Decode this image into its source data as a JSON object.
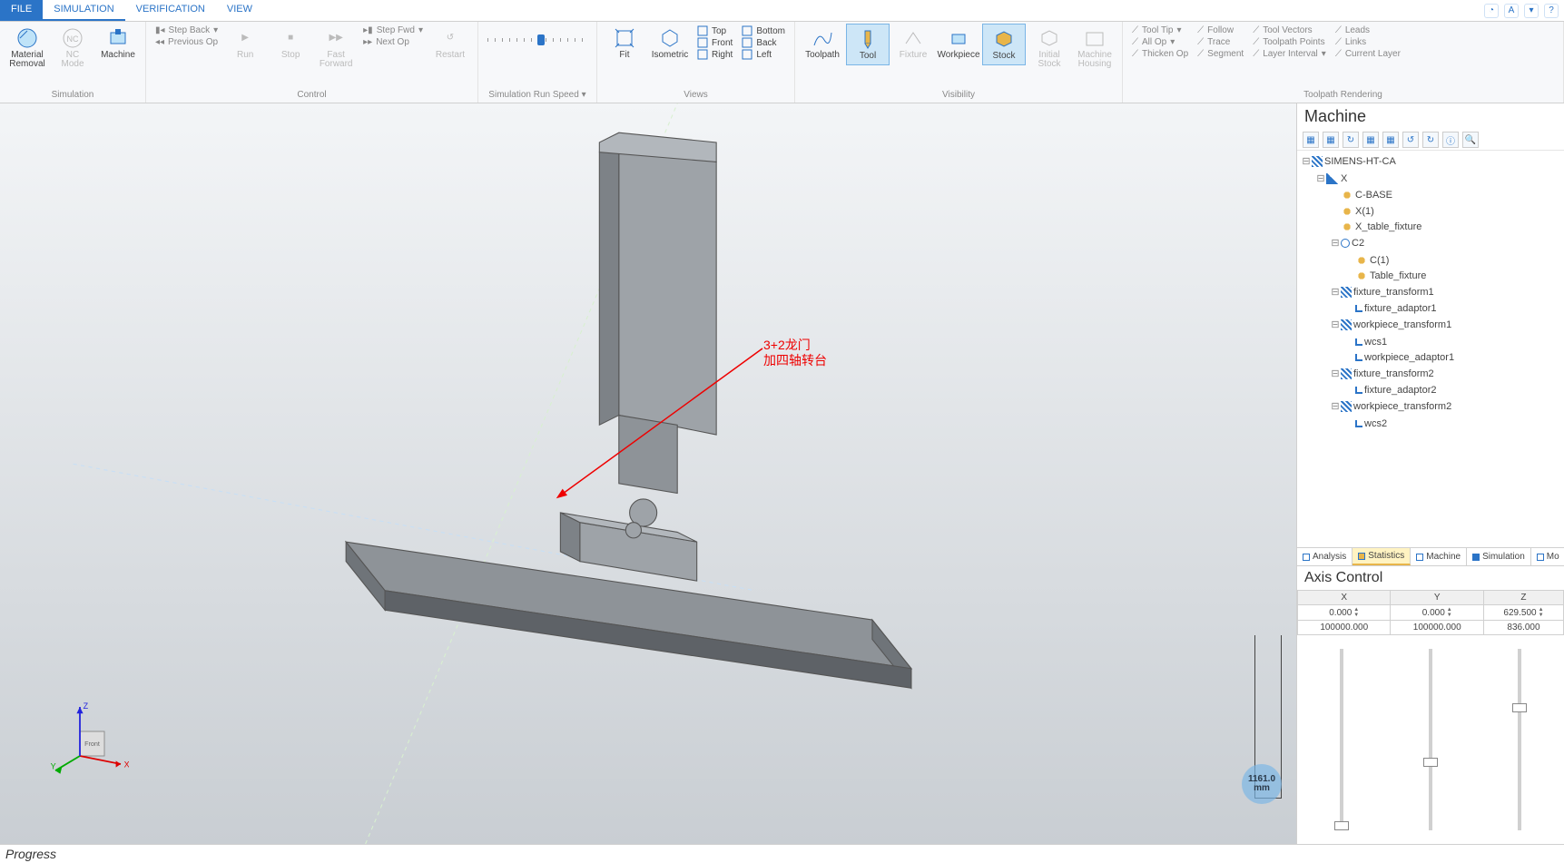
{
  "title_center": "",
  "tabs": {
    "file": "FILE",
    "simulation": "SIMULATION",
    "verification": "VERIFICATION",
    "view": "VIEW"
  },
  "ribbon": {
    "simulation": {
      "label": "Simulation",
      "material_removal": "Material\nRemoval",
      "nc_mode": "NC\nMode",
      "machine": "Machine"
    },
    "control": {
      "label": "Control",
      "step_back": "Step Back",
      "previous_op": "Previous Op",
      "step_fwd": "Step Fwd",
      "next_op": "Next Op",
      "run": "Run",
      "stop": "Stop",
      "fast_forward": "Fast\nForward",
      "restart": "Restart"
    },
    "speed": {
      "label": "Simulation Run Speed"
    },
    "views": {
      "label": "Views",
      "fit": "Fit",
      "isometric": "Isometric",
      "top": "Top",
      "bottom": "Bottom",
      "front": "Front",
      "back": "Back",
      "right": "Right",
      "left": "Left"
    },
    "visibility": {
      "label": "Visibility",
      "toolpath": "Toolpath",
      "tool": "Tool",
      "fixture": "Fixture",
      "workpiece": "Workpiece",
      "stock": "Stock",
      "initial_stock": "Initial\nStock",
      "machine_housing": "Machine\nHousing"
    },
    "render": {
      "label": "Toolpath Rendering",
      "col1": [
        "Tool Tip",
        "All Op",
        "Thicken Op"
      ],
      "col2": [
        "Follow",
        "Trace",
        "Segment"
      ],
      "col3": [
        "Tool Vectors",
        "Toolpath Points",
        "Layer Interval"
      ],
      "col4": [
        "Leads",
        "Links",
        "Current Layer"
      ]
    }
  },
  "viewport": {
    "annotation_line1": "3+2龙门",
    "annotation_line2": "加四轴转台",
    "scale_value": "1161.0",
    "scale_unit": "mm",
    "axes": {
      "x": "X",
      "y": "Y",
      "z": "Z",
      "front": "Front"
    }
  },
  "machine_panel": {
    "title": "Machine",
    "tree": {
      "root": "SIMENS-HT-CA",
      "x": "X",
      "cbase": "C-BASE",
      "x1": "X(1)",
      "xtable": "X_table_fixture",
      "c2": "C2",
      "c1": "C(1)",
      "tablefix": "Table_fixture",
      "ft1": "fixture_transform1",
      "fa1": "fixture_adaptor1",
      "wt1": "workpiece_transform1",
      "wcs1": "wcs1",
      "wa1": "workpiece_adaptor1",
      "ft2": "fixture_transform2",
      "fa2": "fixture_adaptor2",
      "wt2": "workpiece_transform2",
      "wcs2": "wcs2"
    },
    "tabs": {
      "analysis": "Analysis",
      "statistics": "Statistics",
      "machine": "Machine",
      "simulation": "Simulation",
      "mo": "Mo"
    }
  },
  "axis_control": {
    "title": "Axis Control",
    "headers": {
      "x": "X",
      "y": "Y",
      "z": "Z"
    },
    "row1": {
      "x": "0.000",
      "y": "0.000",
      "z": "629.500"
    },
    "row2": {
      "x": "100000.000",
      "y": "100000.000",
      "z": "836.000"
    }
  },
  "progress": {
    "label": "Progress"
  }
}
